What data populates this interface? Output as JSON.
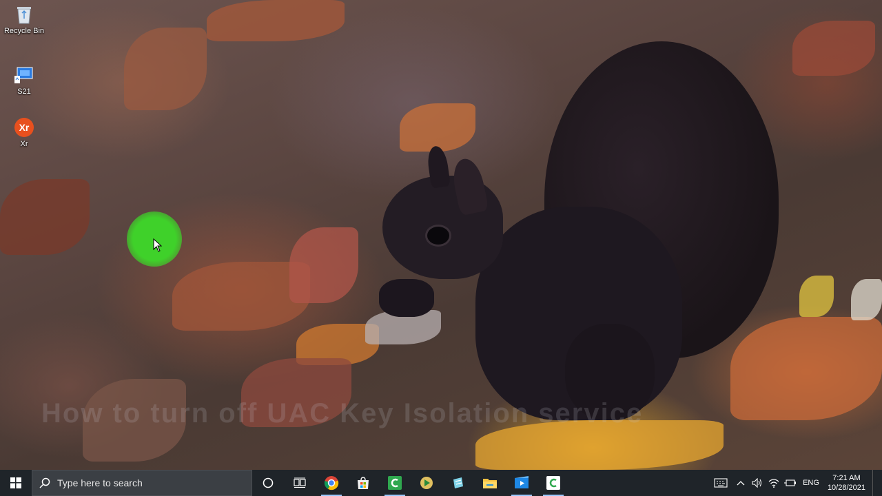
{
  "desktop": {
    "icons": [
      {
        "label": "Recycle Bin",
        "icon": "recycle-bin-icon"
      },
      {
        "label": "S21",
        "icon": "s21-app-icon"
      },
      {
        "label": "Xr",
        "icon": "xr-app-icon"
      }
    ],
    "watermark": "How to turn off UAC Key Isolation service"
  },
  "taskbar": {
    "search_placeholder": "Type here to search",
    "apps": [
      {
        "name": "cortana",
        "icon": "cortana-circle-icon"
      },
      {
        "name": "task-view",
        "icon": "task-view-icon"
      },
      {
        "name": "chrome",
        "icon": "chrome-icon"
      },
      {
        "name": "store",
        "icon": "microsoft-store-icon"
      },
      {
        "name": "camtasia",
        "icon": "camtasia-icon"
      },
      {
        "name": "media-player",
        "icon": "media-player-icon"
      },
      {
        "name": "app-blue",
        "icon": "app-blue-icon"
      },
      {
        "name": "file-explorer",
        "icon": "file-explorer-icon"
      },
      {
        "name": "app-video",
        "icon": "video-app-icon"
      },
      {
        "name": "camtasia-recorder",
        "icon": "camtasia-recorder-icon"
      }
    ],
    "tray": {
      "language": "ENG",
      "time": "7:21 AM",
      "date": "10/28/2021"
    }
  },
  "colors": {
    "taskbar_bg": "#1f2429",
    "cursor_highlight": "#3fd12a",
    "accent": "#9ac7ff"
  }
}
